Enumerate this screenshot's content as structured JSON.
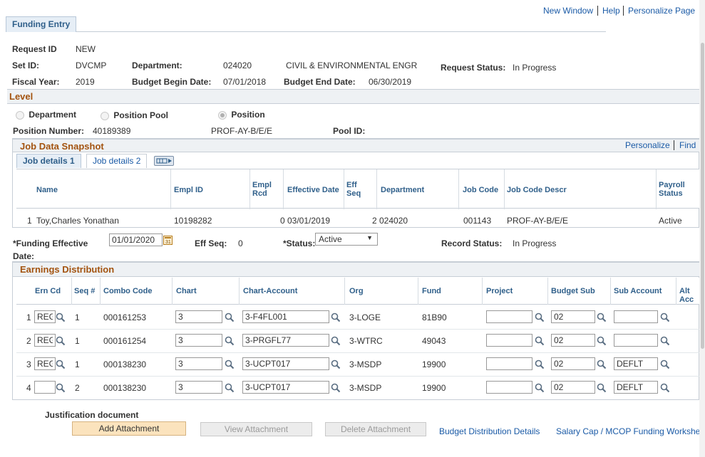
{
  "top_links": {
    "new_window": "New Window",
    "help": "Help",
    "personalize_page": "Personalize Page"
  },
  "tab": {
    "label": "Funding Entry"
  },
  "header": {
    "request_id_label": "Request ID",
    "request_id": "NEW",
    "setid_label": "Set ID:",
    "setid": "DVCMP",
    "department_label": "Department:",
    "department_code": "024020",
    "department_name": "CIVIL & ENVIRONMENTAL ENGR",
    "request_status_label": "Request Status:",
    "request_status": "In Progress",
    "fiscal_year_label": "Fiscal Year:",
    "fiscal_year": "2019",
    "budget_begin_label": "Budget Begin Date:",
    "budget_begin": "07/01/2018",
    "budget_end_label": "Budget End Date:",
    "budget_end": "06/30/2019"
  },
  "level": {
    "title": "Level",
    "options": [
      "Department",
      "Position Pool",
      "Position"
    ],
    "selected": "Position",
    "position_number_label": "Position Number:",
    "position_number": "40189389",
    "position_descr": "PROF-AY-B/E/E",
    "pool_id_label": "Pool ID:"
  },
  "job_data": {
    "title": "Job Data Snapshot",
    "personalize": "Personalize",
    "find": "Find",
    "tabs": [
      "Job details 1",
      "Job details 2"
    ],
    "columns": [
      "Name",
      "Empl ID",
      "Empl Rcd",
      "Effective Date",
      "Eff Seq",
      "Department",
      "Job Code",
      "Job Code Descr",
      "Payroll Status"
    ],
    "rows": [
      {
        "num": "1",
        "name": "Toy,Charles Yonathan",
        "emplid": "10198282",
        "rcd": "0",
        "eff_date": "03/01/2019",
        "eff_seq": "2",
        "dept": "024020",
        "job_code": "001143",
        "descr": "PROF-AY-B/E/E",
        "status": "Active"
      }
    ]
  },
  "funding": {
    "effective_label": "*Funding Effective Date:",
    "effective_date": "01/01/2020",
    "eff_seq_label": "Eff Seq:",
    "eff_seq": "0",
    "status_label": "*Status:",
    "status": "Active",
    "record_status_label": "Record Status:",
    "record_status": "In Progress"
  },
  "earnings": {
    "title": "Earnings Distribution",
    "columns": [
      "Ern Cd",
      "Seq #",
      "Combo Code",
      "Chart",
      "Chart-Account",
      "Org",
      "Fund",
      "Project",
      "Budget Sub",
      "Sub Account",
      "Alt Acc"
    ],
    "rows": [
      {
        "num": "1",
        "erncd": "REG",
        "seq": "1",
        "combo": "000161253",
        "chart": "3",
        "account": "3-F4FL001",
        "org": "3-LOGE",
        "fund": "81B90",
        "project": "",
        "budget_sub": "02",
        "sub_account": ""
      },
      {
        "num": "2",
        "erncd": "REG",
        "seq": "1",
        "combo": "000161254",
        "chart": "3",
        "account": "3-PRGFL77",
        "org": "3-WTRC",
        "fund": "49043",
        "project": "",
        "budget_sub": "02",
        "sub_account": ""
      },
      {
        "num": "3",
        "erncd": "REG",
        "seq": "1",
        "combo": "000138230",
        "chart": "3",
        "account": "3-UCPT017",
        "org": "3-MSDP",
        "fund": "19900",
        "project": "",
        "budget_sub": "02",
        "sub_account": "DEFLT"
      },
      {
        "num": "4",
        "erncd": "",
        "seq": "2",
        "combo": "000138230",
        "chart": "3",
        "account": "3-UCPT017",
        "org": "3-MSDP",
        "fund": "19900",
        "project": "",
        "budget_sub": "02",
        "sub_account": "DEFLT"
      }
    ]
  },
  "footer": {
    "justification": "Justification document",
    "add_attachment": "Add Attachment",
    "view_attachment": "View Attachment",
    "delete_attachment": "Delete Attachment",
    "budget_distribution": "Budget Distribution Details",
    "salary_cap": "Salary Cap / MCOP Funding Workshee"
  },
  "colors": {
    "link": "#1a5aa6",
    "section_title": "#a3530f",
    "primary_button": "#fbe3bd"
  }
}
